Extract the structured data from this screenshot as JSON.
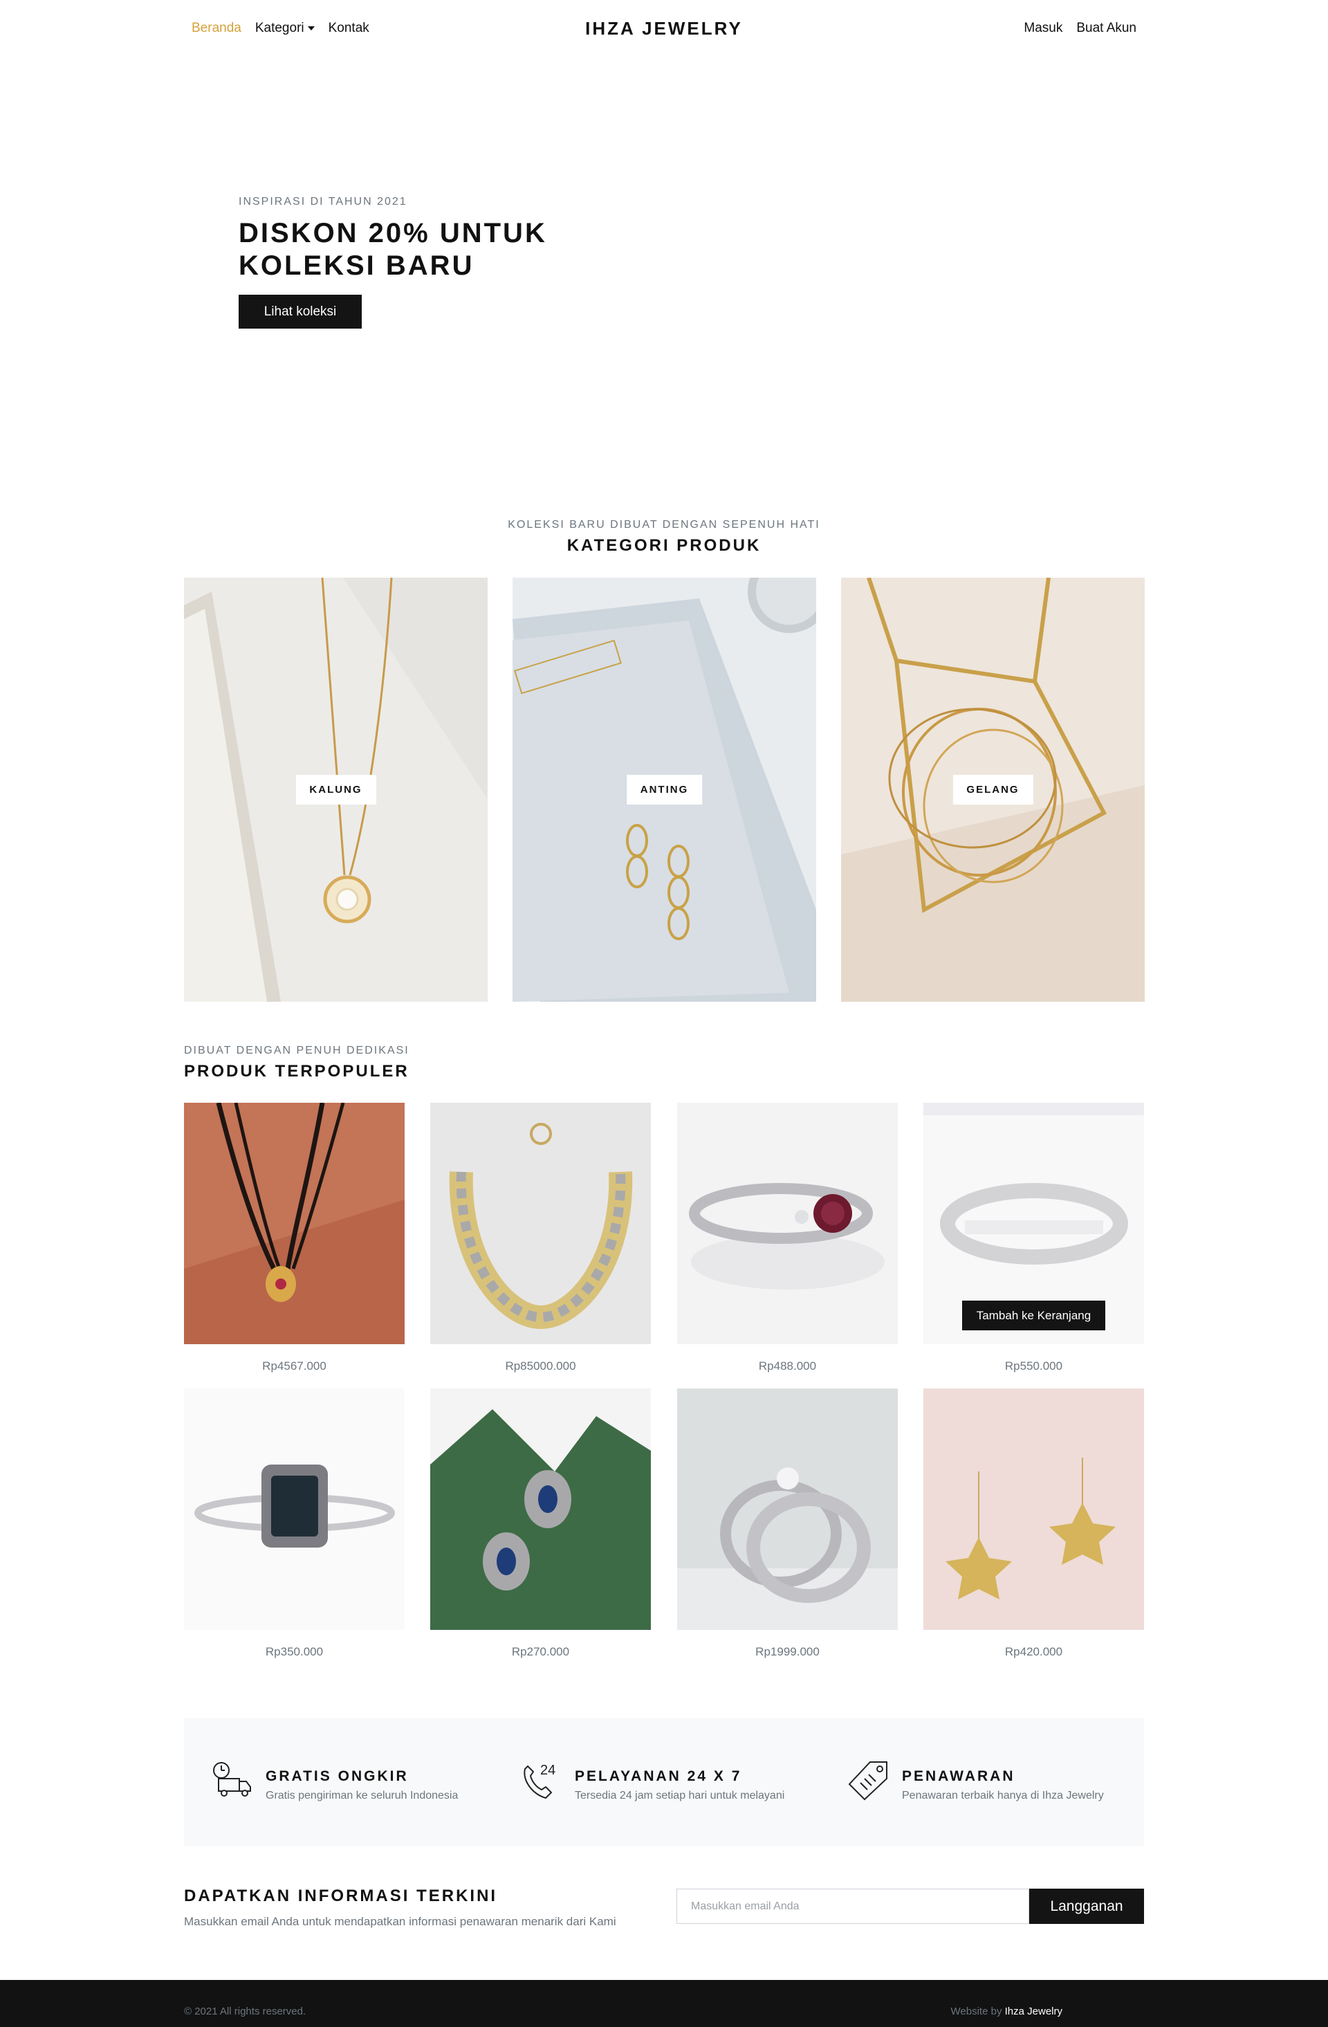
{
  "nav": {
    "left_items": [
      {
        "label": "Beranda",
        "active": true
      },
      {
        "label": "Kategori",
        "dropdown": true
      },
      {
        "label": "Kontak"
      }
    ],
    "brand": "IHZA JEWELRY",
    "right_items": [
      {
        "label": "Masuk"
      },
      {
        "label": "Buat Akun"
      }
    ]
  },
  "hero": {
    "eyebrow": "INSPIRASI DI TAHUN 2021",
    "title_line1": "DISKON 20% UNTUK",
    "title_line2": "KOLEKSI BARU",
    "button": "Lihat koleksi"
  },
  "categories_section": {
    "eyebrow": "KOLEKSI BARU DIBUAT DENGAN SEPENUH HATI",
    "title": "KATEGORI PRODUK",
    "items": [
      {
        "label": "KALUNG"
      },
      {
        "label": "ANTING"
      },
      {
        "label": "GELANG"
      }
    ]
  },
  "popular_section": {
    "eyebrow": "DIBUAT DENGAN PENUH DEDIKASI",
    "title": "PRODUK TERPOPULER",
    "cart_button": "Tambah ke Keranjang",
    "products": [
      {
        "price": "Rp4567.000",
        "image": "black-bead-necklace"
      },
      {
        "price": "Rp85000.000",
        "image": "gold-diamond-necklace"
      },
      {
        "price": "Rp488.000",
        "image": "ruby-ring"
      },
      {
        "price": "Rp550.000",
        "image": "silver-band-ring"
      },
      {
        "price": "Rp350.000",
        "image": "sapphire-halo-ring"
      },
      {
        "price": "Rp270.000",
        "image": "sapphire-earrings-on-leaf"
      },
      {
        "price": "Rp1999.000",
        "image": "wedding-ring-set"
      },
      {
        "price": "Rp420.000",
        "image": "gold-star-earrings"
      }
    ]
  },
  "features": [
    {
      "icon": "delivery-truck-icon",
      "title": "GRATIS ONGKIR",
      "desc": "Gratis pengiriman ke seluruh Indonesia"
    },
    {
      "icon": "phone-24-icon",
      "icon_text": "24",
      "title": "PELAYANAN 24 X 7",
      "desc": "Tersedia 24 jam setiap hari untuk melayani"
    },
    {
      "icon": "price-tag-icon",
      "title": "PENAWARAN",
      "desc": "Penawaran terbaik hanya di Ihza Jewelry"
    }
  ],
  "newsletter": {
    "title": "DAPATKAN INFORMASI TERKINI",
    "desc": "Masukkan email Anda untuk mendapatkan informasi penawaran menarik dari Kami",
    "placeholder": "Masukkan email Anda",
    "button": "Langganan"
  },
  "footer": {
    "copyright": "© 2021 All rights reserved.",
    "credit_prefix": "Website by",
    "credit_name": "Ihza Jewelry"
  },
  "colors": {
    "accent": "#d4a23a",
    "dark": "#141414",
    "muted": "#6c757d"
  }
}
